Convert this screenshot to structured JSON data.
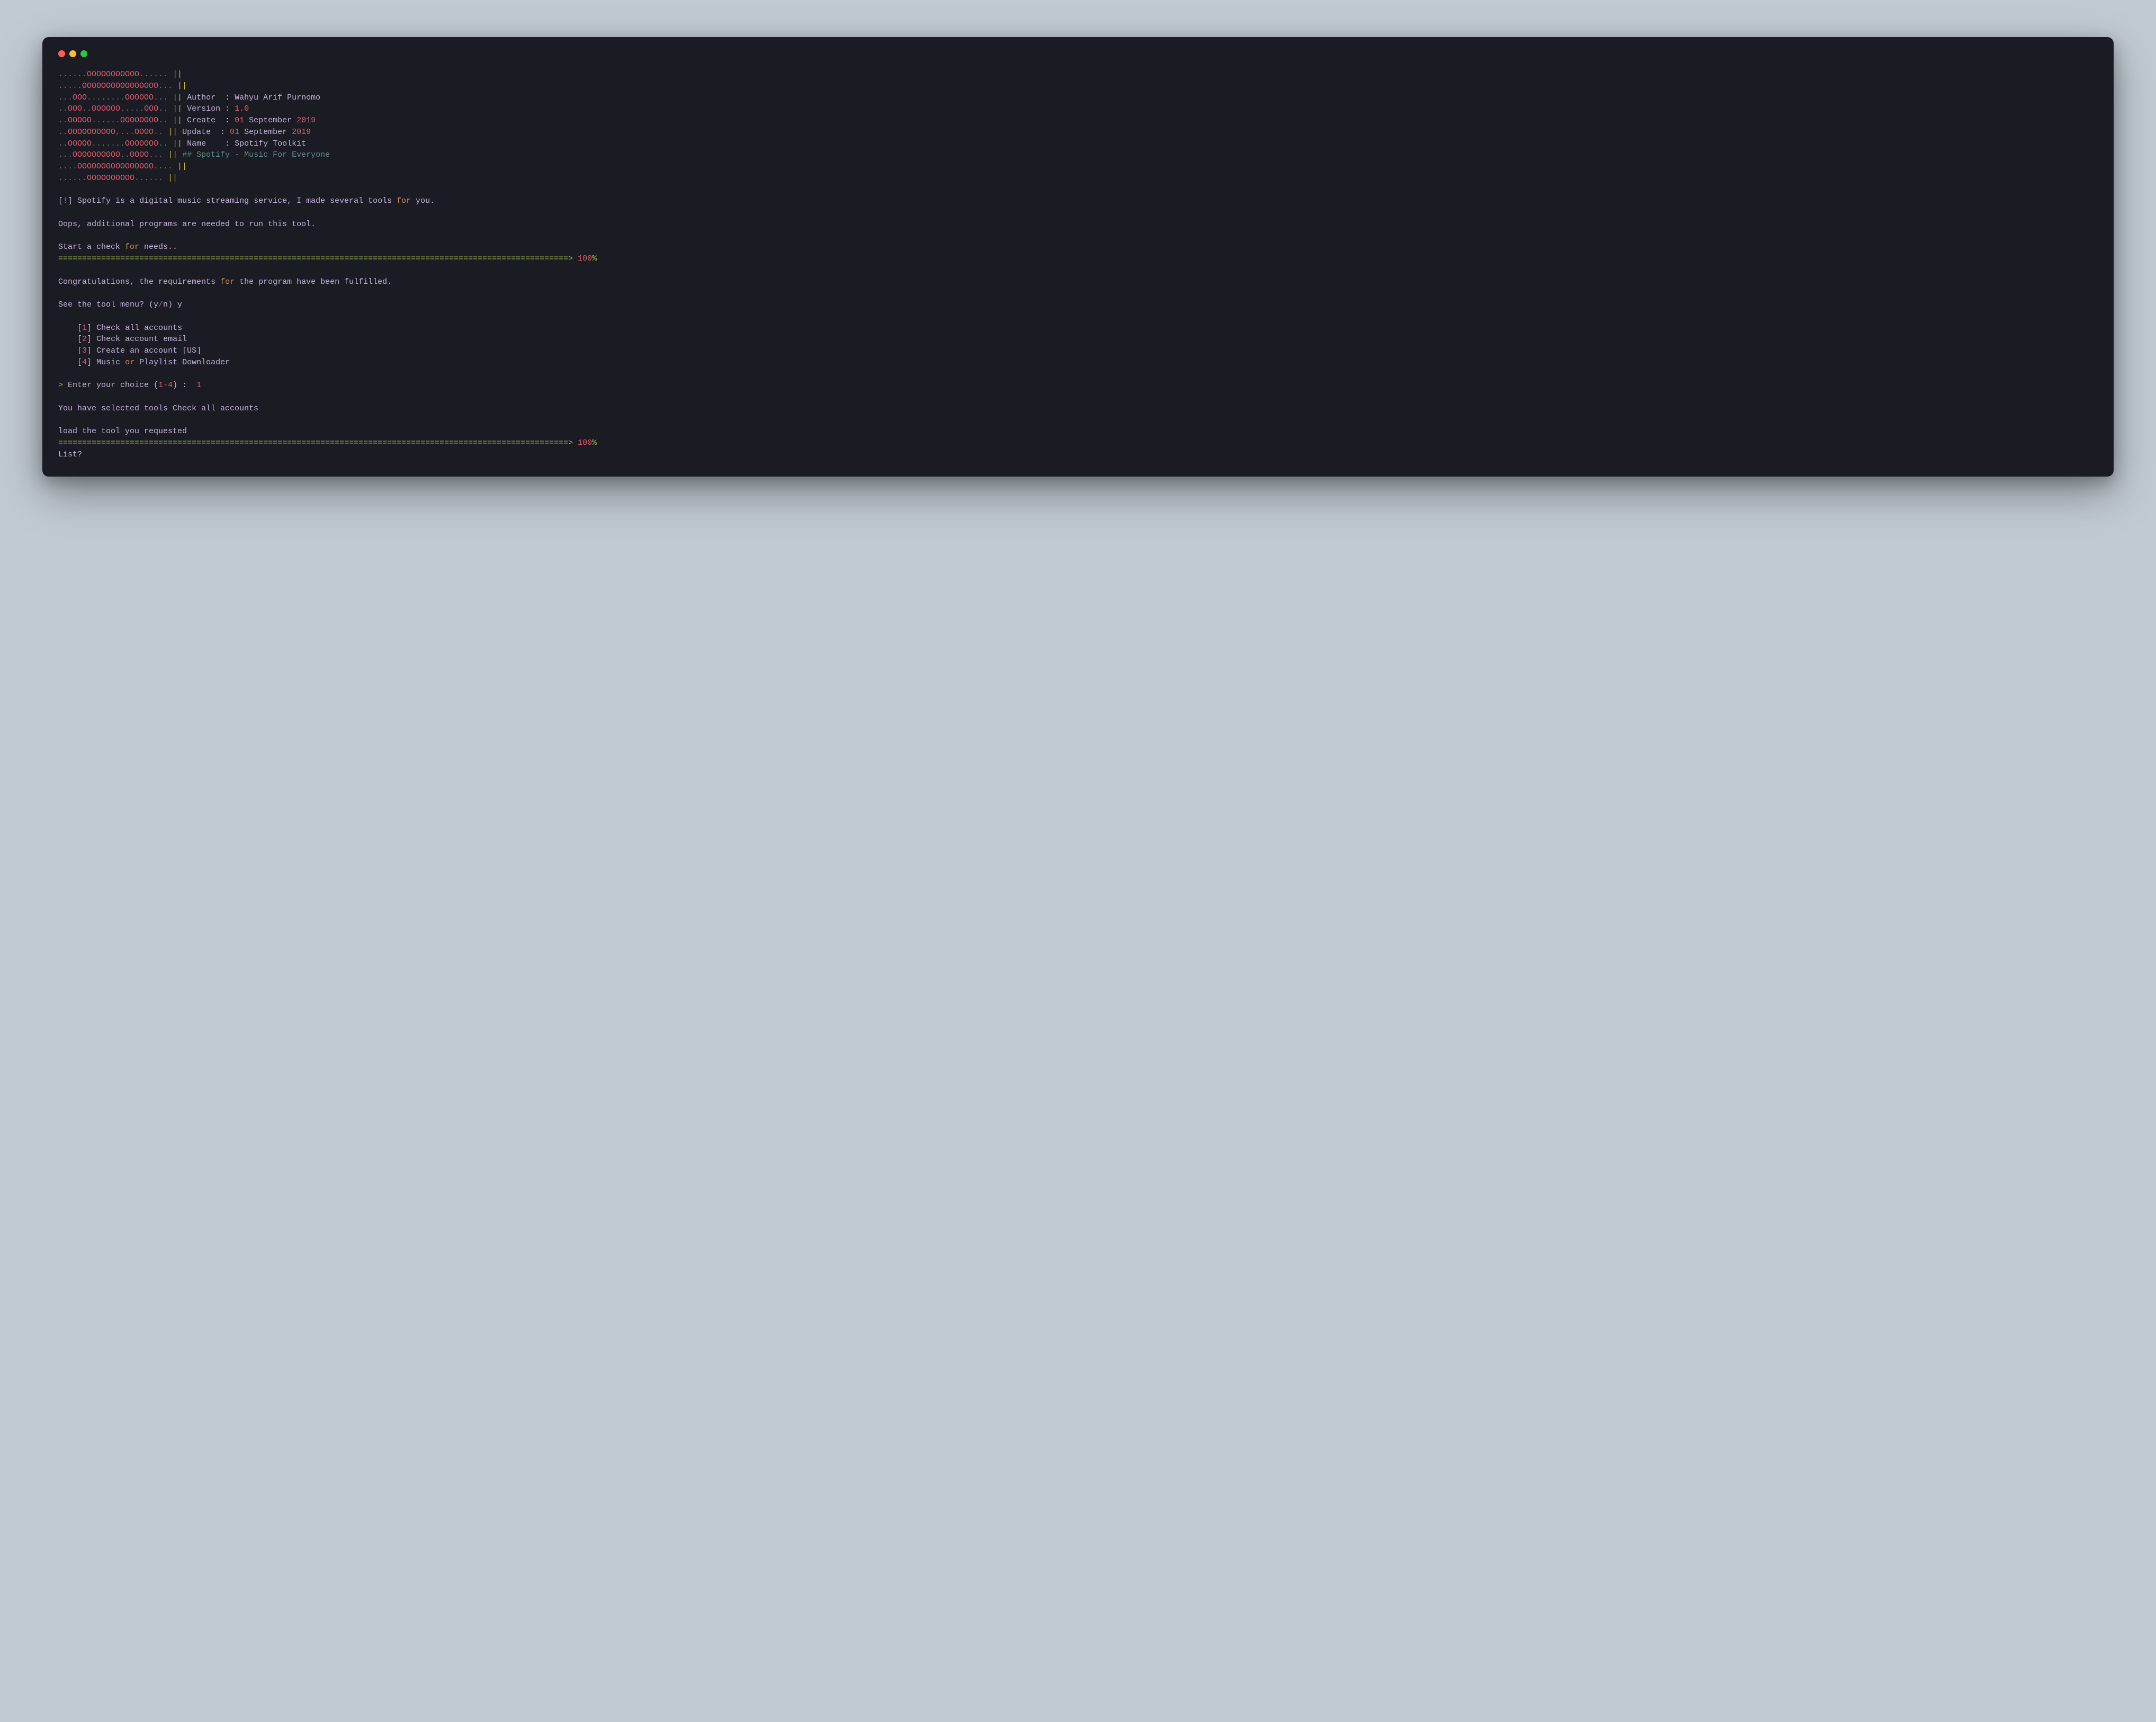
{
  "ascii": {
    "rows": [
      {
        "d1": "......",
        "o": "OOOOOOOOOOO",
        "d2": "......",
        "sep": " || "
      },
      {
        "d1": ".....",
        "o": "OOOOOOOOOOOOOOOO",
        "d2": "...",
        "sep": " || "
      },
      {
        "d1": "...",
        "o": "OOO",
        "d2": "........",
        "o2": "OOOOOO",
        "d3": "...",
        "sep": " || ",
        "lbl": "Author  : ",
        "val": "Wahyu Arif Purnomo"
      },
      {
        "d1": "..",
        "o": "OOO",
        "d2": "..",
        "o2": "OOOOOO",
        "d3": ".....",
        "o3": "OOO",
        "d4": "..",
        "sep": " || ",
        "lbl": "Version : ",
        "r": "1.0"
      },
      {
        "d1": "..",
        "o": "OOOOO",
        "d2": "......",
        "o2": "OOOOOOOO",
        "d3": "..",
        "sep": " || ",
        "lbl": "Create  : ",
        "r": "01",
        "val": " September ",
        "r2": "2019"
      },
      {
        "d1": "..",
        "o": "OOOOOOOOOO",
        "d2": ",...",
        "o2": "OOOO",
        "d3": "..",
        "sep": " || ",
        "lbl": "Update  : ",
        "r": "01",
        "val": " September ",
        "r2": "2019"
      },
      {
        "d1": "..",
        "o": "OOOOO",
        "d2": ".......",
        "o2": "OOOOOOO",
        "d3": "..",
        "sep": " || ",
        "lbl": "Name    : ",
        "val": "Spotify Toolkit"
      },
      {
        "d1": "...",
        "o": "OOOOOOOOOO",
        "d2": "..",
        "o2": "OOOO",
        "d3": "...",
        "sep": " || ",
        "teal": "## Spotify - Music For Everyone"
      },
      {
        "d1": "....",
        "o": "OOOOOOOOOOOOOOOO",
        "d2": "....",
        "sep": " || "
      },
      {
        "d1": "......",
        "o": "OOOOOOOOOO",
        "d2": "......",
        "sep": " || "
      }
    ]
  },
  "tokens": {
    "bang_open": "[",
    "bang": "!",
    "bang_close": "]",
    "for": "for",
    "or": "or",
    "slash": "/",
    "dash": "-",
    "gt": ">",
    "percent": "%",
    "open": "[",
    "close": "]"
  },
  "lines": {
    "intro1a": " Spotify is a digital music streaming service, I made several tools ",
    "intro1b": " you.",
    "oops": "Oops, additional programs are needed to run this tool.",
    "start_a": "Start a check ",
    "start_b": " needs..",
    "bar": "===========================================================================================================> ",
    "bar_val": "100",
    "congrats_a": "Congratulations, the requirements ",
    "congrats_b": " the program have been fulfilled.",
    "see_a": "See the tool menu? (y",
    "see_b": "n) y",
    "m1": "1",
    "m1t": " Check all accounts",
    "m2": "2",
    "m2t": " Check account email",
    "m3": "3",
    "m3t": " Create an account ",
    "m3us": "US",
    "m4": "4",
    "m4ta": " Music ",
    "m4tb": " Playlist Downloader",
    "enter_a": " Enter your choice (",
    "enter_lo": "1",
    "enter_hi": "4",
    "enter_b": ") :  ",
    "enter_val": "1",
    "selected": "You have selected tools Check all accounts",
    "load": "load the tool you requested",
    "list": "List?"
  },
  "indent": "    "
}
